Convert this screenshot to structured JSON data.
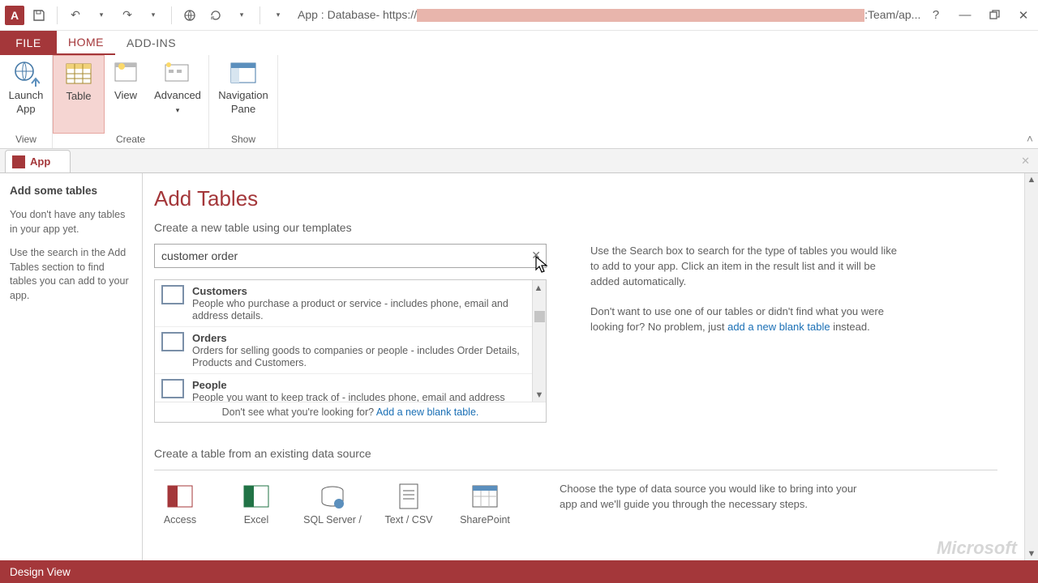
{
  "titlebar": {
    "title_prefix": "App : Database- https://",
    "title_suffix": ":Team/ap..."
  },
  "ribbon": {
    "file": "FILE",
    "tabs": [
      "HOME",
      "ADD-INS"
    ],
    "groups": {
      "view": {
        "launch": "Launch\nApp",
        "label": "View"
      },
      "create": {
        "table": "Table",
        "view": "View",
        "advanced": "Advanced",
        "label": "Create"
      },
      "show": {
        "nav": "Navigation\nPane",
        "label": "Show"
      }
    }
  },
  "doctab": {
    "label": "App"
  },
  "sidebar": {
    "heading": "Add some tables",
    "p1": "You don't have any tables in your app yet.",
    "p2": "Use the search in the Add Tables section to find tables you can add to your app."
  },
  "page": {
    "title": "Add Tables",
    "subtitle": "Create a new table using our templates",
    "search_value": "customer order",
    "help1": "Use the Search box to search for the type of tables you would like to add to your app. Click an item in the result list and it will be added automatically.",
    "help2_pre": "Don't want to use one of our tables or didn't find what you were looking for? No problem, just ",
    "help2_link": "add a new blank table",
    "help2_post": " instead.",
    "results": [
      {
        "name": "Customers",
        "desc": "People who purchase a product or service - includes phone, email and address details."
      },
      {
        "name": "Orders",
        "desc": "Orders for selling goods to companies or people  - includes Order Details, Products and Customers."
      },
      {
        "name": "People",
        "desc": "People you want to keep track of - includes phone, email and address details."
      }
    ],
    "results_footer_pre": "Don't see what you're looking for?  ",
    "results_footer_link": "Add a new blank table.",
    "section2_title": "Create a table from an existing data source",
    "datasources": [
      "Access",
      "Excel",
      "SQL Server /",
      "Text / CSV",
      "SharePoint"
    ],
    "ds_help": "Choose the type of data source you would like to bring into your app and we'll guide you through the necessary steps."
  },
  "status": "Design View"
}
